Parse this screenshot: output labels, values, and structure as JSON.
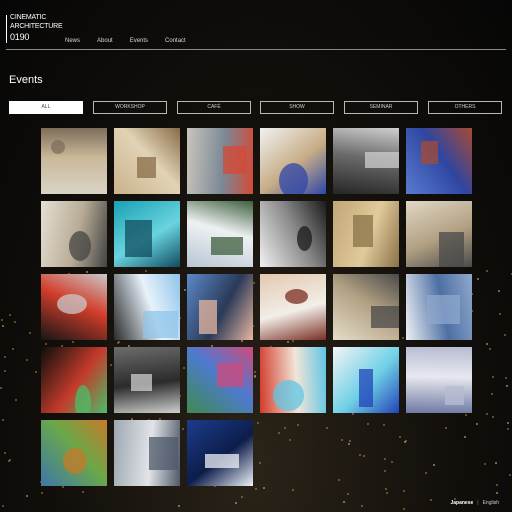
{
  "header": {
    "logo_lines": [
      "CINEMATIC",
      "ARCHITECTURE",
      "0190"
    ],
    "nav": [
      {
        "label": "News"
      },
      {
        "label": "About"
      },
      {
        "label": "Events"
      },
      {
        "label": "Contact"
      }
    ]
  },
  "page_title": "Events",
  "filters": [
    {
      "label": "ALL",
      "active": true
    },
    {
      "label": "WORKSHOP",
      "active": false
    },
    {
      "label": "CAFÉ",
      "active": false
    },
    {
      "label": "SHOW",
      "active": false
    },
    {
      "label": "SEMINAR",
      "active": false
    },
    {
      "label": "OTHERS",
      "active": false
    }
  ],
  "tiles": [
    {
      "name": "beach-photo",
      "colors": [
        "#d9d3c6",
        "#7d6e5b",
        "#cbb999"
      ]
    },
    {
      "name": "blurred-light-photo",
      "colors": [
        "#c9b28b",
        "#8a6b48",
        "#e1d3b6"
      ]
    },
    {
      "name": "red-figure-photo",
      "colors": [
        "#c9c5bb",
        "#d44a35",
        "#7b8897"
      ]
    },
    {
      "name": "striped-awning-photo",
      "colors": [
        "#f1f1f1",
        "#2d46a8",
        "#c7ad86"
      ]
    },
    {
      "name": "window-grid-photo",
      "colors": [
        "#262626",
        "#cfcfcf",
        "#6b6b6b"
      ]
    },
    {
      "name": "red-tower-photo",
      "colors": [
        "#5a7bd1",
        "#a84a33",
        "#2f46a1"
      ]
    },
    {
      "name": "engraving-figure-08",
      "colors": [
        "#e5dfd3",
        "#444",
        "#b7ab95"
      ]
    },
    {
      "name": "teal-interior-photo",
      "colors": [
        "#18a1b3",
        "#0f4d60",
        "#6ad3df"
      ]
    },
    {
      "name": "landscape-tower-photo",
      "colors": [
        "#b8c6d4",
        "#3e5f3e",
        "#eef1f2"
      ]
    },
    {
      "name": "text-collage",
      "colors": [
        "#f2f2f2",
        "#1b1b1b",
        "#888"
      ]
    },
    {
      "name": "stone-wall-photo",
      "colors": [
        "#c2a677",
        "#8a7248",
        "#e0c99a"
      ]
    },
    {
      "name": "engraving-figure-02",
      "colors": [
        "#e1d8c5",
        "#4a4a4a",
        "#b19f82"
      ]
    },
    {
      "name": "tunnel-photo",
      "colors": [
        "#161616",
        "#c9c9c9",
        "#d23d2a"
      ]
    },
    {
      "name": "abstract-blue-photo",
      "colors": [
        "#2a2a2a",
        "#8fc4ea",
        "#e7f2fb"
      ]
    },
    {
      "name": "crowd-dome-photo",
      "colors": [
        "#5b89c9",
        "#e7b7a0",
        "#2a3a58"
      ]
    },
    {
      "name": "portrait-woman-photo",
      "colors": [
        "#e3c9b0",
        "#7a2e23",
        "#f2eee8"
      ]
    },
    {
      "name": "engraving-figure-01",
      "colors": [
        "#e5dcc9",
        "#4a4a4a",
        "#b1a083"
      ]
    },
    {
      "name": "curved-architecture-photo",
      "colors": [
        "#eef1f5",
        "#8fa8cc",
        "#4d6fa3"
      ]
    },
    {
      "name": "night-lights-photo",
      "colors": [
        "#0b0f0b",
        "#4bbe6a",
        "#c43b2b"
      ]
    },
    {
      "name": "grey-motion-photo",
      "colors": [
        "#6c6c6c",
        "#cfcfcf",
        "#2b2b2b"
      ]
    },
    {
      "name": "psychedelic-photo",
      "colors": [
        "#3f8a4f",
        "#d14a7a",
        "#4e7ad1"
      ]
    },
    {
      "name": "goldfish-photo",
      "colors": [
        "#d23a2a",
        "#5fc5e3",
        "#f1e5d8"
      ]
    },
    {
      "name": "blue-stage-photo",
      "colors": [
        "#f3f4f7",
        "#2243b8",
        "#6fd0e6"
      ]
    },
    {
      "name": "cloud-sky-photo",
      "colors": [
        "#6f7aa3",
        "#b7bcd2",
        "#e7e8ef"
      ]
    },
    {
      "name": "colorful-painting",
      "colors": [
        "#3c78a8",
        "#c77a28",
        "#6aa84a"
      ]
    },
    {
      "name": "city-skyline-photo",
      "colors": [
        "#9ea7b2",
        "#4e5868",
        "#e1e4e8"
      ]
    },
    {
      "name": "house-night-photo",
      "colors": [
        "#1b3d8c",
        "#eef1f7",
        "#0d1d4a"
      ]
    }
  ],
  "language": {
    "japanese": "Japanese",
    "separator": "|",
    "english": "English"
  }
}
